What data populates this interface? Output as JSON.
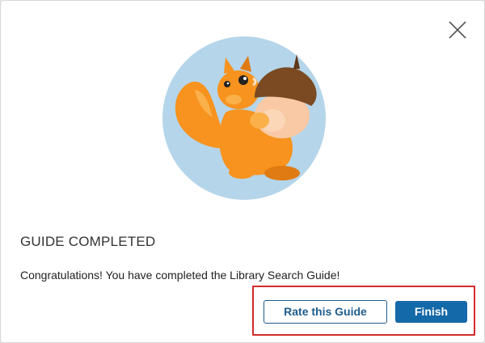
{
  "dialog": {
    "title": "GUIDE COMPLETED",
    "message": "Congratulations! You have completed the Library Search Guide!",
    "close_icon": "close-icon",
    "illustration": "squirrel-with-acorn",
    "buttons": {
      "rate_label": "Rate this Guide",
      "finish_label": "Finish"
    },
    "colors": {
      "primary": "#1469a8",
      "outline_highlight": "#d22a2a",
      "illustration_circle": "#b5d5ea",
      "squirrel": "#f7931e",
      "acorn_cap": "#7b4a22",
      "acorn_nut": "#f8c9a4"
    }
  }
}
